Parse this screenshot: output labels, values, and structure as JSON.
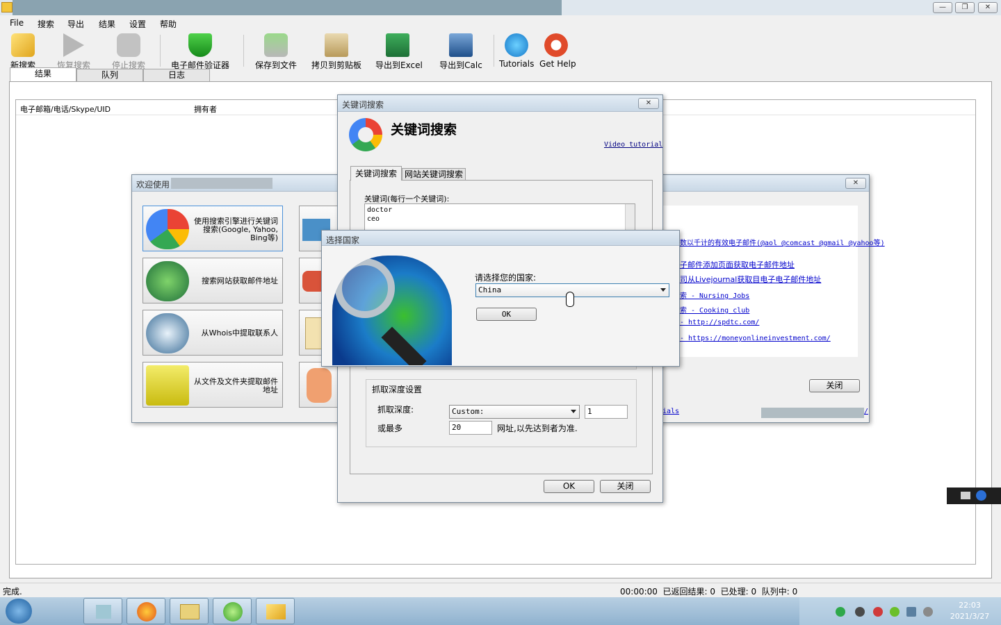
{
  "window": {
    "minimize_glyph": "—",
    "maximize_glyph": "❐",
    "close_glyph": "✕"
  },
  "menu": [
    "File",
    "搜索",
    "导出",
    "结果",
    "设置",
    "帮助"
  ],
  "toolbar": {
    "new_search": "新搜索",
    "resume_search": "恢复搜索",
    "stop_search": "停止搜索",
    "email_verifier": "电子邮件验证器",
    "save_to_file": "保存到文件",
    "copy_to_clipboard": "拷贝到剪贴板",
    "export_excel": "导出到Excel",
    "export_calc": "导出到Calc",
    "tutorials": "Tutorials",
    "get_help": "Get Help"
  },
  "tabs": [
    "结果",
    "队列",
    "日志"
  ],
  "results_table": {
    "columns": [
      "电子邮箱/电话/Skype/UID",
      "拥有者"
    ]
  },
  "welcome_dialog": {
    "title": "欢迎使用",
    "close_glyph": "✕",
    "buttons": [
      "使用搜索引擎进行关键词搜索(Google, Yahoo, Bing等)",
      "搜索网站获取邮件地址",
      "从Whois中提取联系人",
      "从文件及文件夹提取邮件地址"
    ],
    "links": [
      "数以千计的有效电子邮件(@aol @comcast @gmail @yahoo等)",
      "子邮件添加页面获取电子邮件地址",
      "司从Livejournal获取目电子电子邮件地址",
      "索 - Nursing Jobs",
      "索 - Cooking club",
      "- http://spdtc.com/",
      "- https://moneyonlineinvestment.com/"
    ],
    "close_button": "关闭",
    "tutorials_link": "ials",
    "right_link_fragment": "/"
  },
  "keyword_dialog": {
    "title": "关键词搜索",
    "close_glyph": "✕",
    "heading": "关键词搜索",
    "video_tutorial": "Video tutorial",
    "tabs": [
      "关键词搜索",
      "网站关键词搜索"
    ],
    "keywords_label": "关键词(每行一个关键词):",
    "keywords": "doctor\nceo",
    "depth_group": "抓取深度设置",
    "depth_label": "抓取深度:",
    "depth_select": "Custom:",
    "depth_value": "1",
    "max_label": "或最多",
    "max_value": "20",
    "max_suffix": "网址,以先达到者为准.",
    "ok": "OK",
    "close": "关闭"
  },
  "country_dialog": {
    "title": "选择国家",
    "prompt": "请选择您的国家:",
    "selected_country": "China",
    "ok": "OK"
  },
  "status": {
    "left": "完成.",
    "right": "00:00:00  已返回结果: 0  已处理: 0  队列中: 0"
  },
  "tray": {
    "time": "22:03",
    "date": "2021/3/27"
  },
  "colors": {
    "accent": "#0000cc",
    "taskbar": "#a9c4da"
  }
}
